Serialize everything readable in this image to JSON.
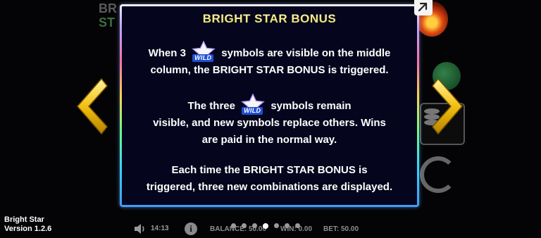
{
  "background": {
    "logo_top": "BR",
    "logo_bottom": "ST"
  },
  "dialog": {
    "title": "BRIGHT STAR BONUS",
    "wild_label": "WILD",
    "p1_before": "When 3",
    "p1_after": "symbols are visible on the middle",
    "p1_line2": "column, the BRIGHT STAR BONUS is triggered.",
    "p2_before": "The three",
    "p2_after": "symbols remain",
    "p2_line2": "visible, and new symbols replace others. Wins",
    "p2_line3": "are paid in the normal way.",
    "p3_line1": "Each time the BRIGHT STAR BONUS is",
    "p3_line2": "triggered, three new combinations are displayed."
  },
  "footer": {
    "game_name": "Bright Star",
    "version": "Version 1.2.6",
    "time": "14:13",
    "balance_label": "BALANCE: 50.00",
    "win_label": "WIN: 0.00",
    "bet_label": "BET: 50.00",
    "page_count": 7,
    "active_page": 4
  },
  "colors": {
    "arrow": "#f2c010",
    "panel_bg": "#05051d",
    "wild_badge": "#1f4fd1"
  },
  "icons": {
    "left": "chevron-left-icon",
    "right": "chevron-right-icon",
    "close": "close-icon",
    "speaker": "speaker-icon",
    "info": "info-icon"
  }
}
